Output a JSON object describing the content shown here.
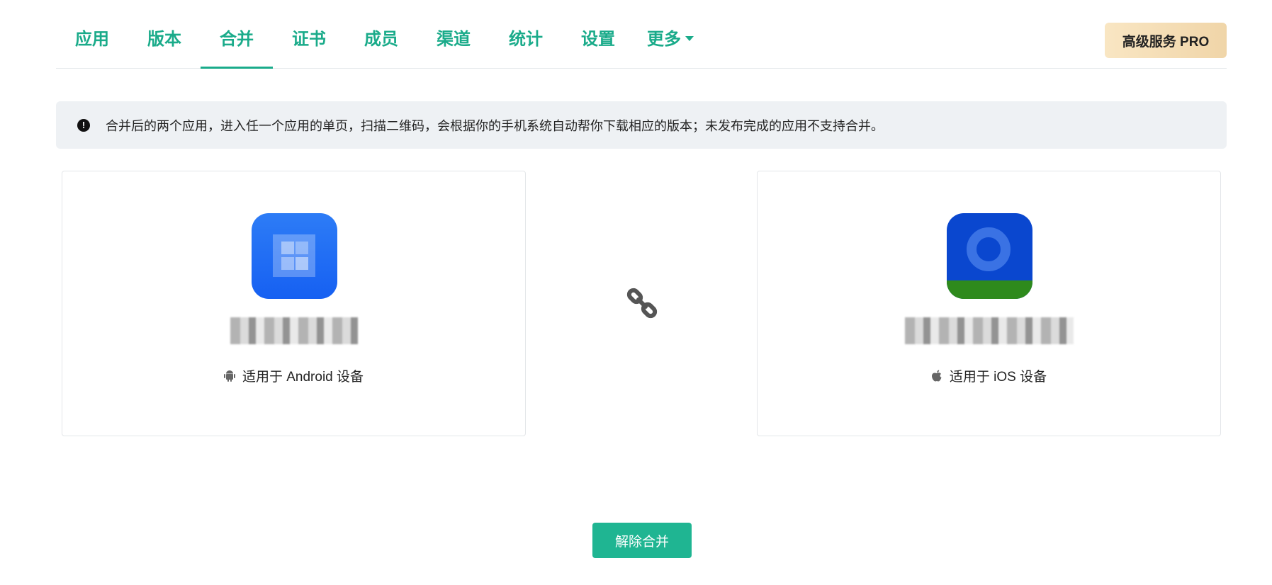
{
  "nav": {
    "tabs": [
      {
        "label": "应用"
      },
      {
        "label": "版本"
      },
      {
        "label": "合并"
      },
      {
        "label": "证书"
      },
      {
        "label": "成员"
      },
      {
        "label": "渠道"
      },
      {
        "label": "统计"
      },
      {
        "label": "设置"
      },
      {
        "label": "更多"
      }
    ],
    "active_tab": "合并",
    "pro_label": "高级服务 PRO"
  },
  "alert": {
    "text": "合并后的两个应用，进入任一个应用的单页，扫描二维码，会根据你的手机系统自动帮你下载相应的版本；未发布完成的应用不支持合并。"
  },
  "cards": {
    "android": {
      "platform_label": "适用于 Android 设备",
      "icon": "android-icon"
    },
    "ios": {
      "platform_label": "适用于 iOS 设备",
      "icon": "apple-icon"
    }
  },
  "link_icon": "link-icon",
  "unmerge_label": "解除合并",
  "colors": {
    "accent": "#1aab8a",
    "button": "#1fb592",
    "alert_bg": "#eef1f4",
    "pro_bg": "#f3dbb0"
  }
}
